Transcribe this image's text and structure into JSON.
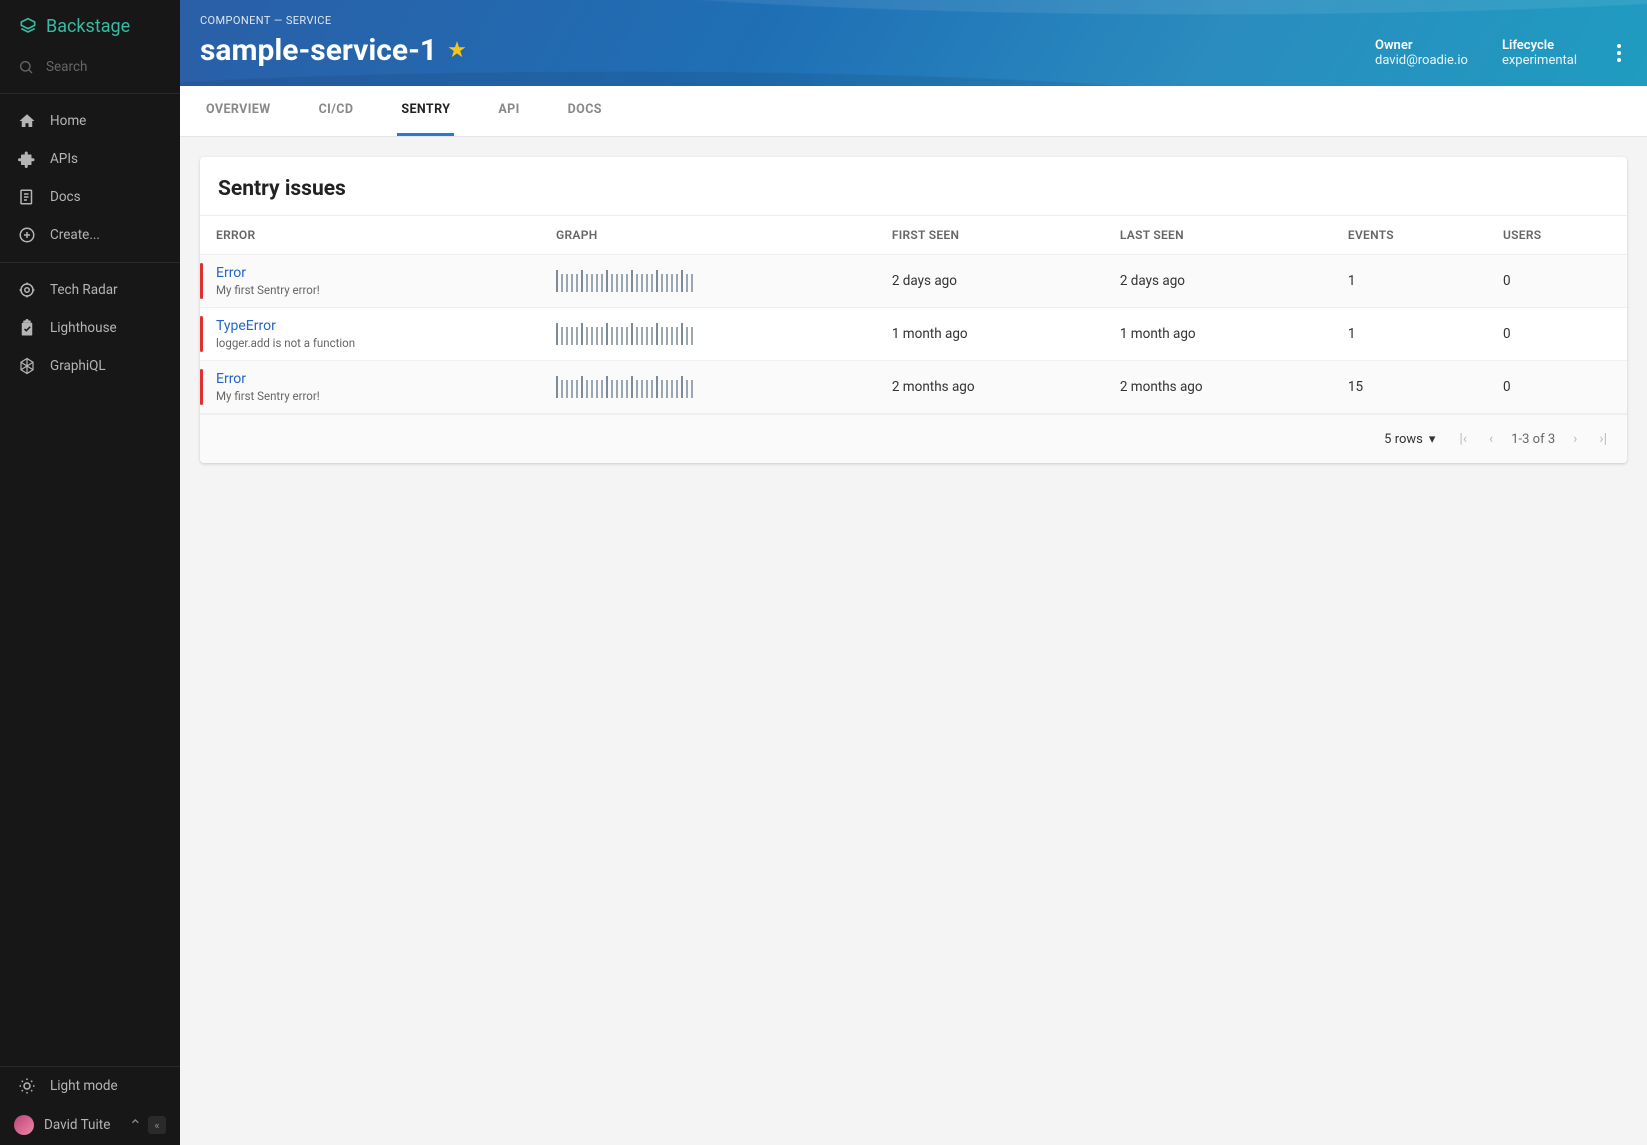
{
  "app": {
    "name": "Backstage"
  },
  "search": {
    "placeholder": "Search"
  },
  "sidebar": {
    "primary": [
      {
        "label": "Home",
        "icon": "home"
      },
      {
        "label": "APIs",
        "icon": "puzzle"
      },
      {
        "label": "Docs",
        "icon": "docs"
      },
      {
        "label": "Create...",
        "icon": "plus-circle"
      }
    ],
    "secondary": [
      {
        "label": "Tech Radar",
        "icon": "target"
      },
      {
        "label": "Lighthouse",
        "icon": "clipboard-check"
      },
      {
        "label": "GraphiQL",
        "icon": "graphql"
      }
    ],
    "footer": {
      "theme_toggle": "Light mode",
      "user": "David Tuite"
    }
  },
  "header": {
    "breadcrumb": "COMPONENT — SERVICE",
    "title": "sample-service-1",
    "meta": {
      "owner_label": "Owner",
      "owner_value": "david@roadie.io",
      "lifecycle_label": "Lifecycle",
      "lifecycle_value": "experimental"
    }
  },
  "tabs": [
    {
      "label": "OVERVIEW",
      "active": false
    },
    {
      "label": "CI/CD",
      "active": false
    },
    {
      "label": "SENTRY",
      "active": true
    },
    {
      "label": "API",
      "active": false
    },
    {
      "label": "DOCS",
      "active": false
    }
  ],
  "card": {
    "title": "Sentry issues",
    "columns": [
      "ERROR",
      "GRAPH",
      "FIRST SEEN",
      "LAST SEEN",
      "EVENTS",
      "USERS"
    ],
    "rows": [
      {
        "title": "Error",
        "sub": "My first Sentry error!",
        "first_seen": "2 days ago",
        "last_seen": "2 days ago",
        "events": "1",
        "users": "0"
      },
      {
        "title": "TypeError",
        "sub": "logger.add is not a function",
        "first_seen": "1 month ago",
        "last_seen": "1 month ago",
        "events": "1",
        "users": "0"
      },
      {
        "title": "Error",
        "sub": "My first Sentry error!",
        "first_seen": "2 months ago",
        "last_seen": "2 months ago",
        "events": "15",
        "users": "0"
      }
    ],
    "footer": {
      "rows_label": "5 rows",
      "page_info": "1-3 of 3"
    }
  }
}
